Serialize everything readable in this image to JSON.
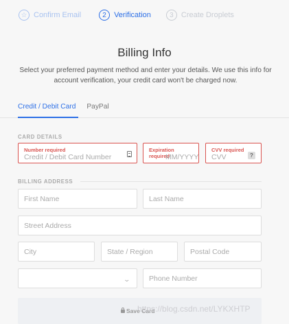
{
  "steps": [
    {
      "num": "☆",
      "label": "Confirm Email"
    },
    {
      "num": "2",
      "label": "Verification"
    },
    {
      "num": "3",
      "label": "Create Droplets"
    }
  ],
  "page": {
    "title": "Billing Info",
    "subtitle": "Select your preferred payment method and enter your details. We use this info for account verification, your credit card won't be charged now."
  },
  "tabs": {
    "card": "Credit / Debit Card",
    "paypal": "PayPal"
  },
  "card_details": {
    "section": "CARD DETAILS",
    "number": {
      "error": "Number required",
      "placeholder": "Credit / Debit Card Number"
    },
    "expiration": {
      "error": "Expiration required",
      "placeholder": "MM/YYYY"
    },
    "cvv": {
      "error": "CVV required",
      "placeholder": "CVV",
      "help": "?"
    }
  },
  "billing": {
    "section": "BILLING ADDRESS",
    "first_name": "First Name",
    "last_name": "Last Name",
    "street": "Street Address",
    "city": "City",
    "state": "State / Region",
    "postal": "Postal Code",
    "country": "",
    "phone": "Phone Number"
  },
  "save_label": "Save Card",
  "watermark": "https://blog.csdn.net/LYKXHTP",
  "colors": {
    "accent": "#2b6ee6",
    "error": "#d9534f"
  }
}
